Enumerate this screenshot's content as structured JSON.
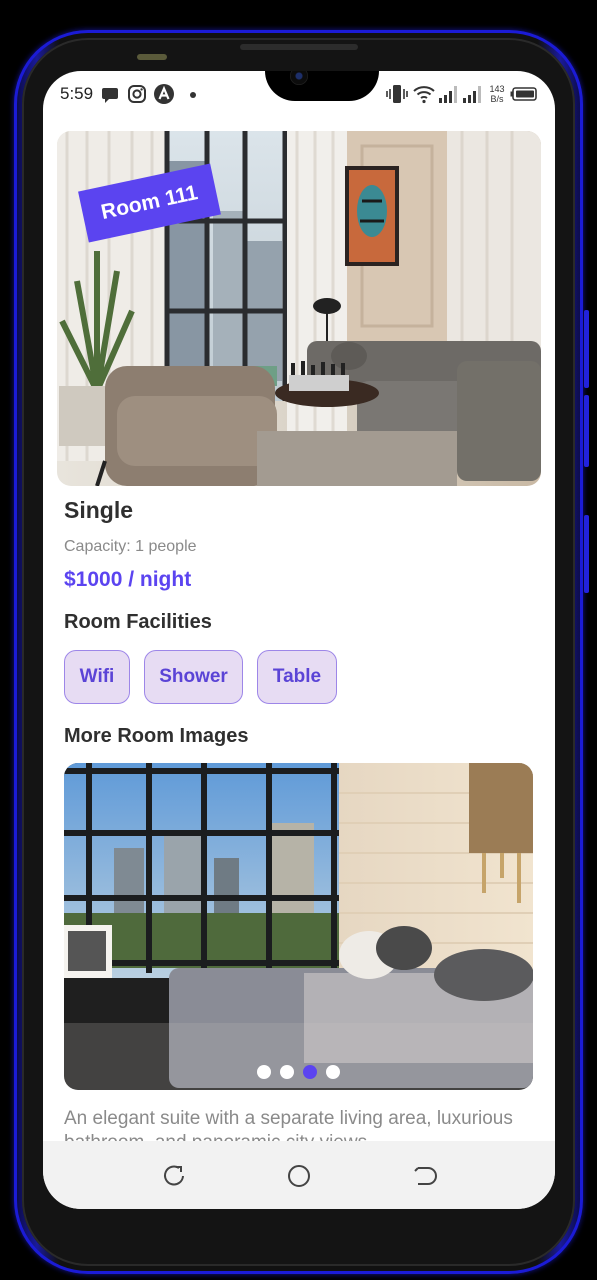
{
  "status_bar": {
    "time": "5:59",
    "net_speed_value": "143",
    "net_speed_unit": "B/s",
    "left_icons": [
      "message-icon",
      "instagram-icon",
      "app-a-icon",
      "dot-icon"
    ],
    "right_icons": [
      "vibrate-icon",
      "wifi-icon",
      "signal-icon",
      "signal-icon",
      "battery-icon"
    ]
  },
  "room": {
    "tag": "Room 111",
    "type": "Single",
    "capacity": "Capacity: 1 people",
    "price": "$1000 / night",
    "description": "An elegant suite with a separate living area, luxurious bathroom, and panoramic city views."
  },
  "facilities": {
    "title": "Room Facilities",
    "items": [
      "Wifi",
      "Shower",
      "Table"
    ]
  },
  "gallery": {
    "title": "More Room Images",
    "slide_count": 4,
    "active_index": 2
  },
  "colors": {
    "accent": "#5b44f0",
    "chip_bg": "#e7dcf3",
    "chip_border": "#9d86e8",
    "frame_blue": "#1b1bd6"
  },
  "nav_bar": {
    "icons": [
      "recents-icon",
      "home-icon",
      "back-icon"
    ]
  }
}
